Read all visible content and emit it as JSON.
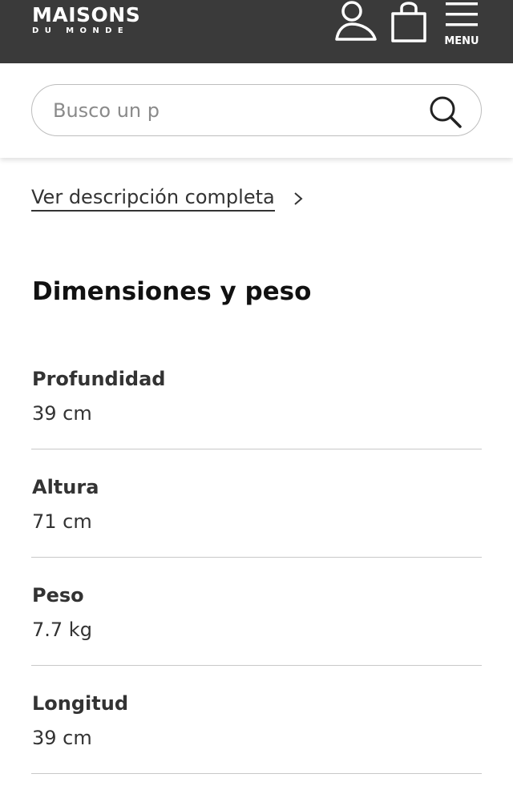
{
  "header": {
    "logo_main": "MAISONS",
    "logo_sub": "DU MONDE",
    "menu_label": "MENU",
    "background": "#3a3a3a"
  },
  "search": {
    "placeholder": "Busco un p"
  },
  "description": {
    "link_label": "Ver descripción completa"
  },
  "dimensions": {
    "title": "Dimensiones y peso",
    "rows": [
      {
        "label": "Profundidad",
        "value": "39 cm"
      },
      {
        "label": "Altura",
        "value": "71 cm"
      },
      {
        "label": "Peso",
        "value": "7.7 kg"
      },
      {
        "label": "Longitud",
        "value": "39 cm"
      }
    ]
  }
}
